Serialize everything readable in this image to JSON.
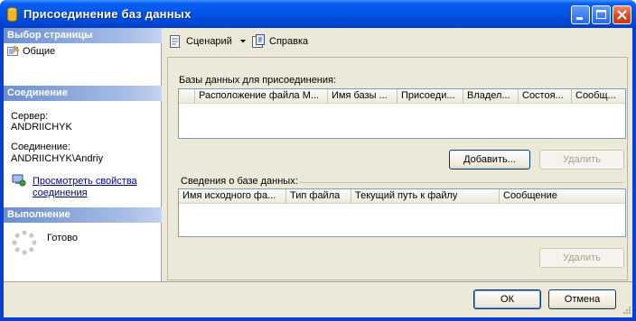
{
  "window": {
    "title": "Присоединение баз данных"
  },
  "left": {
    "select_page_header": "Выбор страницы",
    "page_general": "Общие",
    "connection_header": "Соединение",
    "server_label": "Сервер:",
    "server_value": "ANDRIICHYK",
    "connection_label": "Соединение:",
    "connection_value": "ANDRIICHYK\\Andriy",
    "view_props_line1": "Просмотреть свойства",
    "view_props_line2": "соединения",
    "progress_header": "Выполнение",
    "status": "Готово"
  },
  "toolbar": {
    "script_label": "Сценарий",
    "help_label": "Справка"
  },
  "main": {
    "databases_label": "Базы данных для присоединения:",
    "databases_columns": [
      "",
      "Расположение файла М...",
      "Имя базы ...",
      "Присоеди...",
      "Владел...",
      "Состоя...",
      "Сообщ..."
    ],
    "add_button": "Добавить...",
    "remove_button_1": "Удалить",
    "details_label": "Сведения о базе данных:",
    "details_columns": [
      "Имя исходного фа...",
      "Тип файла",
      "Текущий путь к файлу",
      "Сообщение"
    ],
    "remove_button_2": "Удалить"
  },
  "footer": {
    "ok": "ОК",
    "cancel": "Отмена"
  }
}
